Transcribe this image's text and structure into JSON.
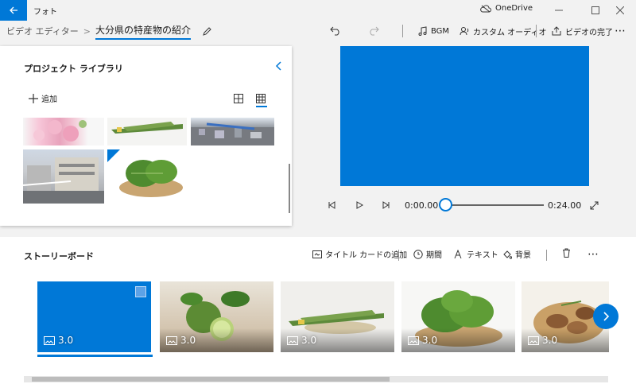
{
  "titlebar": {
    "app_title": "フォト",
    "onedrive_label": "OneDrive"
  },
  "breadcrumb": {
    "parent": "ビデオ エディター",
    "separator": ">",
    "current": "大分県の特産物の紹介"
  },
  "toolbar": {
    "bgm_label": "BGM",
    "custom_audio_label": "カスタム オーディオ",
    "finish_video_label": "ビデオの完了",
    "more_label": "⋯"
  },
  "library": {
    "title": "プロジェクト ライブラリ",
    "add_label": "追加",
    "items": [
      {
        "name": "pink-flowers"
      },
      {
        "name": "grass-bundle"
      },
      {
        "name": "city-view"
      },
      {
        "name": "building-street"
      },
      {
        "name": "green-leaves"
      }
    ]
  },
  "player": {
    "current_time": "0:00.00",
    "total_time": "0:24.00",
    "progress": 0
  },
  "storyboard": {
    "title": "ストーリーボード",
    "add_title_card_label": "タイトル カードの追加",
    "duration_label": "期間",
    "text_label": "テキスト",
    "background_label": "背景",
    "more_label": "⋯",
    "clips": [
      {
        "duration": "3.0",
        "kind": "blank"
      },
      {
        "duration": "3.0",
        "kind": "citrus"
      },
      {
        "duration": "3.0",
        "kind": "grass"
      },
      {
        "duration": "3.0",
        "kind": "leaves"
      },
      {
        "duration": "3.0",
        "kind": "mushrooms"
      }
    ]
  },
  "colors": {
    "accent": "#0078d7"
  }
}
